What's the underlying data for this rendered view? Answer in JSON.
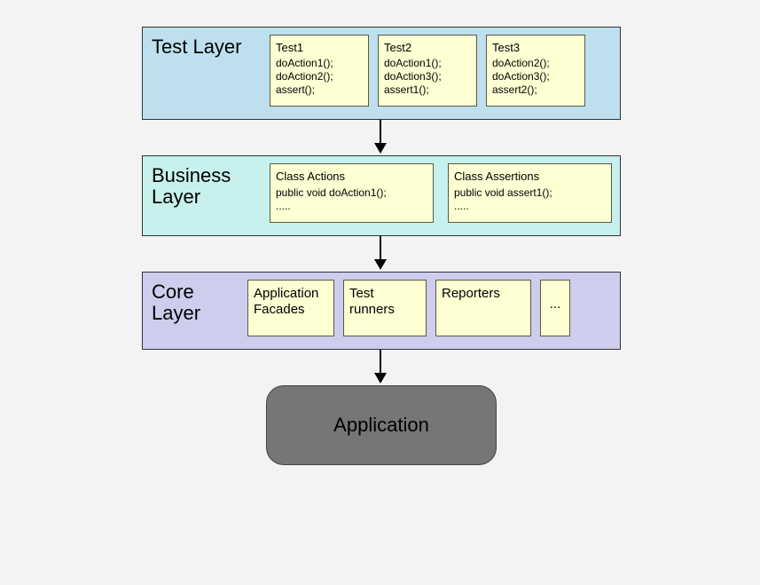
{
  "layers": {
    "test": {
      "title": "Test Layer",
      "boxes": [
        {
          "title": "Test1",
          "lines": [
            "doAction1();",
            "doAction2();",
            "assert();"
          ]
        },
        {
          "title": "Test2",
          "lines": [
            "doAction1();",
            "doAction3();",
            "assert1();"
          ]
        },
        {
          "title": "Test3",
          "lines": [
            "doAction2();",
            "doAction3();",
            "assert2();"
          ]
        }
      ]
    },
    "business": {
      "title": "Business Layer",
      "boxes": [
        {
          "title": "Class Actions",
          "lines": [
            "public void doAction1();",
            "....."
          ]
        },
        {
          "title": "Class Assertions",
          "lines": [
            "public void assert1();",
            "....."
          ]
        }
      ]
    },
    "core": {
      "title": "Core Layer",
      "boxes": [
        {
          "title": "Application Facades"
        },
        {
          "title": "Test runners"
        },
        {
          "title": "Reporters"
        },
        {
          "title": "..."
        }
      ]
    }
  },
  "application": {
    "label": "Application"
  }
}
